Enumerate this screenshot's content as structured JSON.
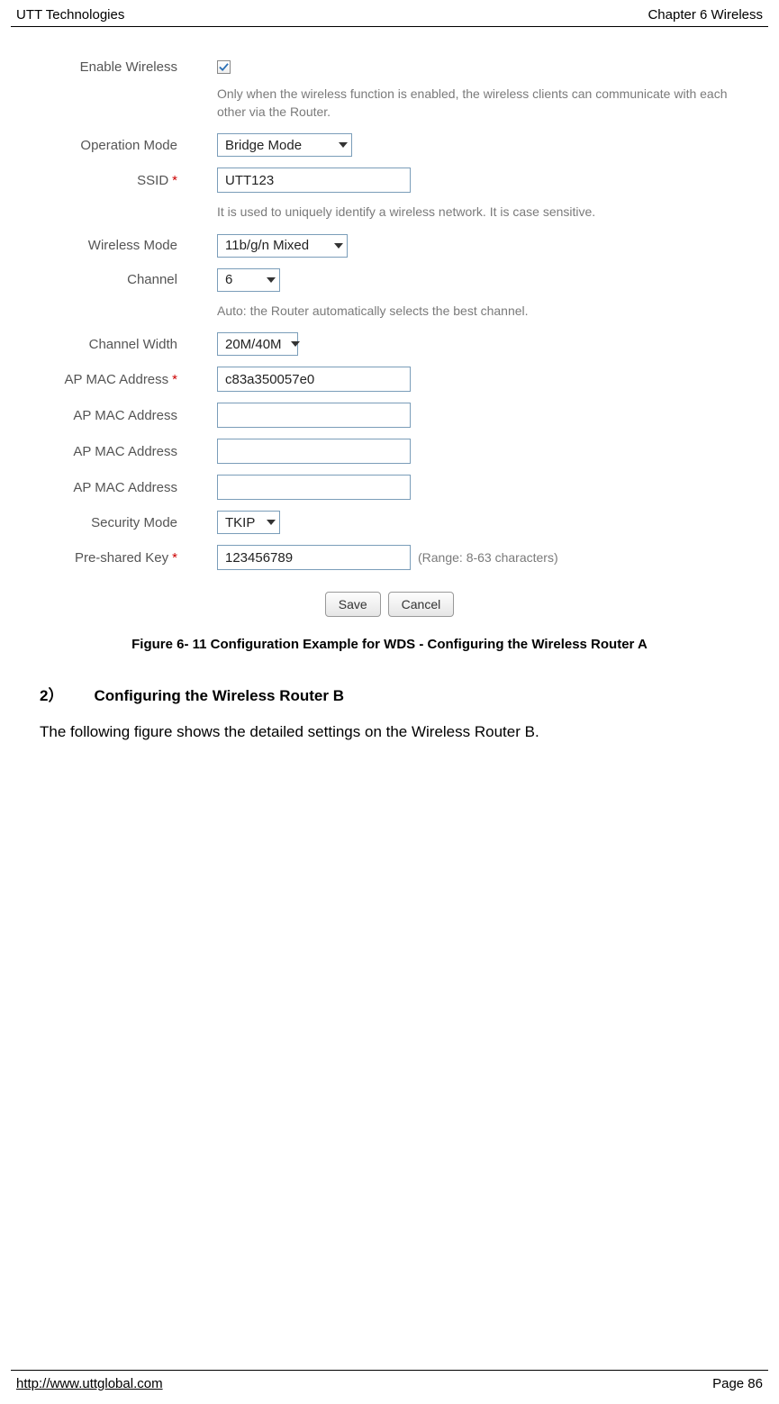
{
  "header": {
    "left": "UTT Technologies",
    "right": "Chapter 6 Wireless"
  },
  "form": {
    "enable_wireless_label": "Enable Wireless",
    "enable_wireless_help": "Only when the wireless function is enabled, the wireless clients can communicate with each other via the Router.",
    "operation_mode_label": "Operation Mode",
    "operation_mode_value": "Bridge Mode",
    "ssid_label": "SSID",
    "ssid_value": "UTT123",
    "ssid_help": "It is used to uniquely identify a wireless network. It is case sensitive.",
    "wireless_mode_label": "Wireless Mode",
    "wireless_mode_value": "11b/g/n Mixed",
    "channel_label": "Channel",
    "channel_value": "6",
    "channel_help": "Auto: the Router automatically selects the best channel.",
    "channel_width_label": "Channel Width",
    "channel_width_value": "20M/40M",
    "ap_mac_label": "AP MAC Address",
    "ap_mac1_value": "c83a350057e0",
    "ap_mac2_value": "",
    "ap_mac3_value": "",
    "ap_mac4_value": "",
    "security_mode_label": "Security Mode",
    "security_mode_value": "TKIP",
    "psk_label": "Pre-shared Key",
    "psk_value": "123456789",
    "psk_range": "(Range: 8-63 characters)",
    "save_label": "Save",
    "cancel_label": "Cancel"
  },
  "caption": "Figure 6- 11 Configuration Example for WDS - Configuring the Wireless Router A",
  "section": {
    "heading": "2）  Configuring the Wireless Router B",
    "body": "The following figure shows the detailed settings on the Wireless Router B."
  },
  "footer": {
    "url": "http://www.uttglobal.com",
    "page": "Page 86"
  }
}
